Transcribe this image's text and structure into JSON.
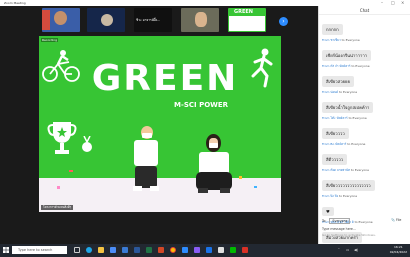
{
  "window": {
    "title": "Zoom Meeting"
  },
  "participants": {
    "thumbs": [
      {
        "name": ""
      },
      {
        "name": ""
      },
      {
        "name": "ชีวะ อาจารย์ผึ้ง..."
      },
      {
        "name": ""
      },
      {
        "name": "GREEN"
      }
    ]
  },
  "stage": {
    "title": "GREEN",
    "subtitle": "M-SCI POWER",
    "recording_label": "Recording",
    "speaker_label": "โครงการตัวแทนสิ่งดีๆ"
  },
  "chat": {
    "header": "Chat",
    "messages": [
      {
        "from": "",
        "to": "",
        "text": "กกกกก"
      },
      {
        "from": "From ชาเขียว",
        "to": "to Everyone",
        "text": "เชียร์น้องกรีนน่าาาาาา"
      },
      {
        "from": "From กัส จำ นัทธ์ตาร์",
        "to": "to Everyone",
        "text": "สีเขียวสวยยย"
      },
      {
        "from": "From ปอนด์",
        "to": "to Everyone",
        "text": "สีเขียวน้ำใจถูกสเปคค้าา"
      },
      {
        "from": "From โต๊ะ นัทธ์ตาร์",
        "to": "to Everyone",
        "text": "สีเขียวววว"
      },
      {
        "from": "From Bo นัทธ์ตาร์",
        "to": "to Everyone",
        "text": "สีดีววววว"
      },
      {
        "from": "From ก๊อด บายพานัท",
        "to": "to Everyone",
        "text": "สีเขียววววววววววววววว"
      },
      {
        "from": "From ปิง ปิง",
        "to": "to Everyone",
        "text": "♥"
      },
      {
        "from": "From ฟลุค ดัชส์ ไอ้ดั้ง ฮิ",
        "to": "to Everyone",
        "text": "สีม่วงสวยมากคร่า"
      }
    ],
    "to_label": "To:",
    "recipient": "Everyone",
    "file_label": "File",
    "input_placeholder": "Type message here...",
    "activate_text": "Go to Settings to activate Windows."
  },
  "taskbar": {
    "search_placeholder": "Type here to search",
    "time": "16:21",
    "date": "02/04/2022"
  },
  "colors": {
    "stage_green": "#37c534",
    "zoom_blue": "#2d8cff",
    "chat_name": "#2b7bd0"
  }
}
